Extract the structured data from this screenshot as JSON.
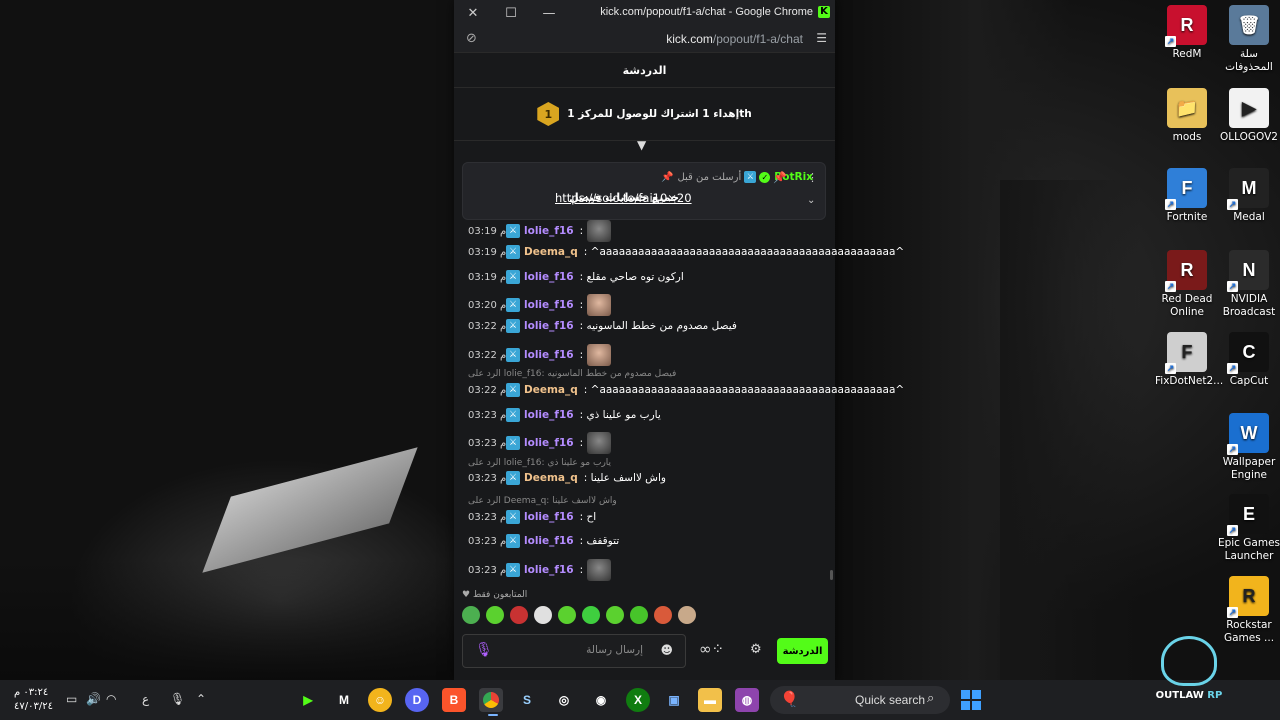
{
  "window": {
    "title": "kick.com/popout/f1-a/chat - Google Chrome",
    "url_host": "kick.com",
    "url_path": "/popout/f1-a/chat",
    "controls": {
      "close": "✕",
      "maximize": "☐",
      "minimize": "—"
    }
  },
  "chat": {
    "header": "الدردشة",
    "goal": {
      "badge": "1",
      "text": "إهداء 1 اشتراك للوصول للمركز 1th"
    },
    "pinned": {
      "label": "أرسلت من قبل",
      "sender": "BotRix",
      "message": "جميع حسابات فيصل",
      "link": "https://solo.to/fai10×20"
    },
    "messages": [
      {
        "time": "03:19 م",
        "user": "lolie_f16",
        "color": "purple",
        "text": ":"
      },
      {
        "time": "03:19 م",
        "user": "Deema_q",
        "color": "gold",
        "text": ": ^aaaaaaaaaaaaaaaaaaaaaaaaaaaaaaaaaaaaaaaaaaaaaa^"
      },
      {
        "time": "03:19 م",
        "user": "lolie_f16",
        "color": "purple",
        "text": ": اركون توه صاحي مقلع"
      },
      {
        "time": "03:20 م",
        "user": "lolie_f16",
        "color": "purple",
        "text": ":"
      },
      {
        "time": "03:22 م",
        "user": "lolie_f16",
        "color": "purple",
        "text": ": فيصل مصدوم من خطط الماسونيه"
      },
      {
        "time": "03:22 م",
        "user": "lolie_f16",
        "color": "purple",
        "text": ":"
      },
      {
        "time": "03:22 م",
        "user": "Deema_q",
        "color": "gold",
        "text": ": ^aaaaaaaaaaaaaaaaaaaaaaaaaaaaaaaaaaaaaaaaaaaaaa^"
      },
      {
        "time": "03:23 م",
        "user": "lolie_f16",
        "color": "purple",
        "text": ": يارب مو علينا ذي"
      },
      {
        "time": "03:23 م",
        "user": "lolie_f16",
        "color": "purple",
        "text": ":"
      },
      {
        "time": "03:23 م",
        "user": "Deema_q",
        "color": "gold",
        "text": ": واش لااسف علينا"
      },
      {
        "time": "03:23 م",
        "user": "lolie_f16",
        "color": "purple",
        "text": ": اح"
      },
      {
        "time": "03:23 م",
        "user": "lolie_f16",
        "color": "purple",
        "text": ": تتوقفف"
      },
      {
        "time": "03:23 م",
        "user": "lolie_f16",
        "color": "purple",
        "text": ":"
      }
    ],
    "replies": [
      "الرد على lolie_f16: فيصل مصدوم من خطط الماسونيه",
      "الرد على lolie_f16: يارب مو علينا ذي",
      "الرد على Deema_q: واش لااسف علينا"
    ],
    "subs_only": "المتابعون فقط",
    "input_placeholder": "إرسال رسالة",
    "send_button": "الدردشة"
  },
  "desktop_icons": [
    {
      "label": "RedM",
      "color": "#c8102e",
      "glyph": "R"
    },
    {
      "label": "سلة المحذوفات",
      "color": "#5a7a9a",
      "glyph": "🗑"
    },
    {
      "label": "mods",
      "color": "#e8c15a",
      "glyph": "📁"
    },
    {
      "label": "OLLOGOV2",
      "color": "#f2f2f2",
      "glyph": "▶"
    },
    {
      "label": "Fortnite",
      "color": "#2f7fd8",
      "glyph": "F"
    },
    {
      "label": "Medal",
      "color": "#222222",
      "glyph": "M"
    },
    {
      "label": "Red Dead Online",
      "color": "#7a1a1a",
      "glyph": "R"
    },
    {
      "label": "NVIDIA Broadcast",
      "color": "#2b2b2b",
      "glyph": "N"
    },
    {
      "label": "FixDotNet2...",
      "color": "#cfcfcf",
      "glyph": "F"
    },
    {
      "label": "CapCut",
      "color": "#111111",
      "glyph": "C"
    },
    {
      "label": "Wallpaper Engine",
      "color": "#1a6fd0",
      "glyph": "W"
    },
    {
      "label": "Epic Games Launcher",
      "color": "#111111",
      "glyph": "E"
    },
    {
      "label": "Rockstar Games ...",
      "color": "#f2b41c",
      "glyph": "R"
    }
  ],
  "taskbar": {
    "search_label": "Quick search",
    "clock_time": "٠٣:٢٤ م",
    "clock_date": "٤٧/٠٣/٢٤",
    "lang": "ع",
    "brand": {
      "name_a": "OUTLAW",
      "name_b": "RP"
    }
  }
}
